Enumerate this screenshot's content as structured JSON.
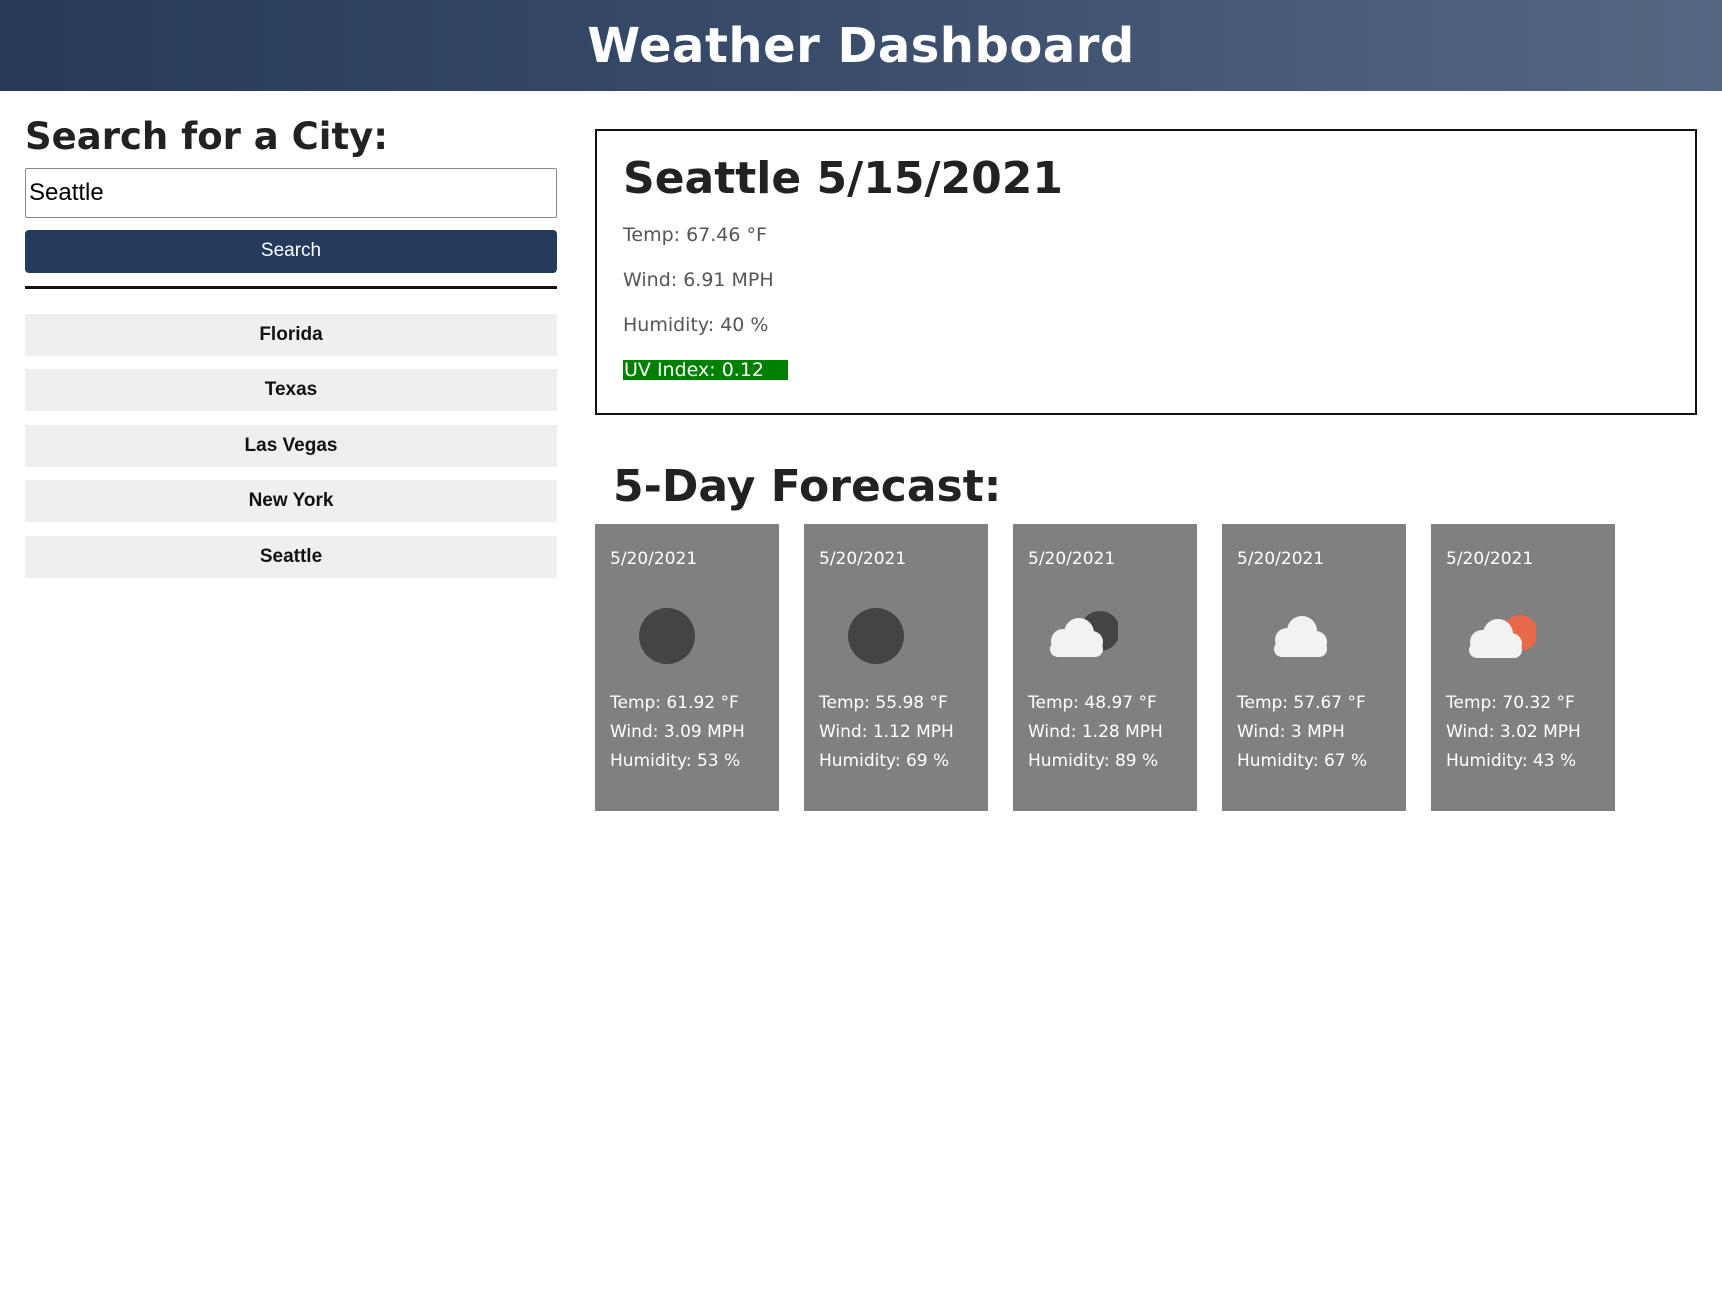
{
  "header": {
    "title": "Weather Dashboard"
  },
  "search": {
    "heading": "Search for a City:",
    "input_value": "Seattle",
    "button_label": "Search"
  },
  "history": [
    {
      "label": "Florida"
    },
    {
      "label": "Texas"
    },
    {
      "label": "Las Vegas"
    },
    {
      "label": "New York"
    },
    {
      "label": "Seattle"
    }
  ],
  "current": {
    "title": "Seattle 5/15/2021",
    "temp": "Temp: 67.46 °F",
    "wind": "Wind: 6.91 MPH",
    "humidity": "Humidity: 40 %",
    "uv": "UV Index: 0.12",
    "uv_color": "#008000"
  },
  "forecast": {
    "title": "5-Day Forecast:",
    "days": [
      {
        "date": "5/20/2021",
        "icon": "moon-icon",
        "temp": "Temp: 61.92 °F",
        "wind": "Wind: 3.09 MPH",
        "humidity": "Humidity: 53 %"
      },
      {
        "date": "5/20/2021",
        "icon": "moon-icon",
        "temp": "Temp: 55.98 °F",
        "wind": "Wind: 1.12 MPH",
        "humidity": "Humidity: 69 %"
      },
      {
        "date": "5/20/2021",
        "icon": "cloud-moon-icon",
        "temp": "Temp: 48.97 °F",
        "wind": "Wind: 1.28 MPH",
        "humidity": "Humidity: 89 %"
      },
      {
        "date": "5/20/2021",
        "icon": "cloud-icon",
        "temp": "Temp: 57.67 °F",
        "wind": "Wind: 3 MPH",
        "humidity": "Humidity: 67 %"
      },
      {
        "date": "5/20/2021",
        "icon": "cloud-sun-icon",
        "temp": "Temp: 70.32 °F",
        "wind": "Wind: 3.02 MPH",
        "humidity": "Humidity: 43 %"
      }
    ]
  },
  "colors": {
    "header_start": "#263959",
    "header_end": "#566782",
    "search_button": "#253b5e",
    "card_background": "#808080",
    "uv_background": "#008000"
  }
}
